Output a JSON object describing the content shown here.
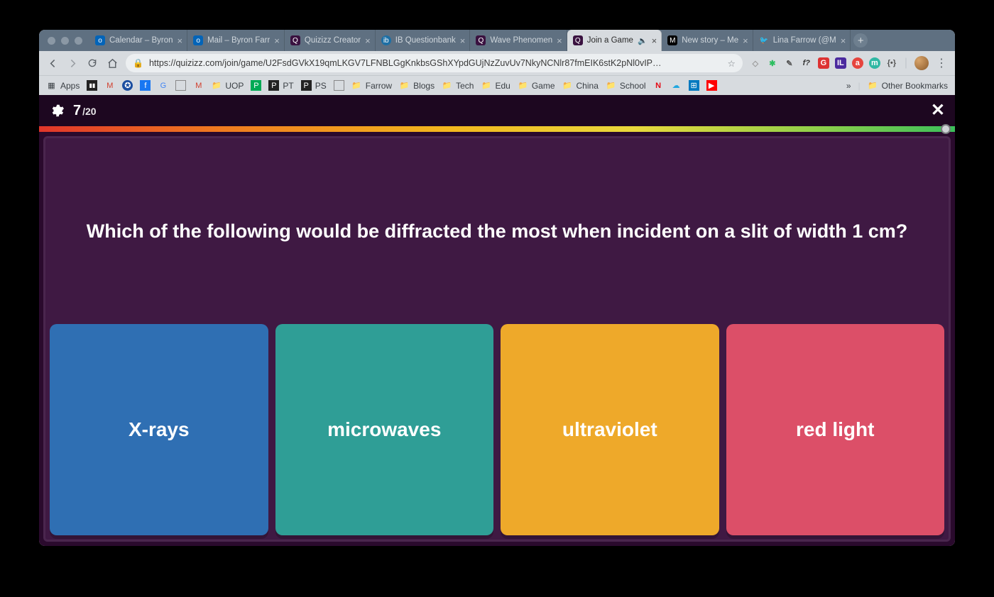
{
  "browser": {
    "tabs": [
      {
        "title": "Calendar – Byron"
      },
      {
        "title": "Mail – Byron Farr"
      },
      {
        "title": "Quizizz Creator"
      },
      {
        "title": "IB Questionbank"
      },
      {
        "title": "Wave Phenomen"
      },
      {
        "title": "Join a Game"
      },
      {
        "title": "New story – Me"
      },
      {
        "title": "Lina Farrow (@M"
      }
    ],
    "active_tab_index": 5,
    "url": "https://quizizz.com/join/game/U2FsdGVkX19qmLKGV7LFNBLGgKnkbsGShXYpdGUjNzZuvUv7NkyNCNlr87fmEIK6stK2pNl0vIP…",
    "bookmarks": [
      {
        "label": "Apps",
        "icon": "grid"
      },
      {
        "label": "",
        "icon": "box"
      },
      {
        "label": "",
        "icon": "gmail"
      },
      {
        "label": "",
        "icon": "circle-blue"
      },
      {
        "label": "",
        "icon": "fb"
      },
      {
        "label": "",
        "icon": "google"
      },
      {
        "label": "",
        "icon": "doc"
      },
      {
        "label": "",
        "icon": "gmail2"
      },
      {
        "label": "UOP",
        "icon": "folder"
      },
      {
        "label": "",
        "icon": "p-green"
      },
      {
        "label": "PT",
        "icon": "p-dark"
      },
      {
        "label": "PS",
        "icon": "p-dark"
      },
      {
        "label": "",
        "icon": "doc"
      },
      {
        "label": "Farrow",
        "icon": "folder"
      },
      {
        "label": "Blogs",
        "icon": "folder"
      },
      {
        "label": "Tech",
        "icon": "folder"
      },
      {
        "label": "Edu",
        "icon": "folder"
      },
      {
        "label": "Game",
        "icon": "folder"
      },
      {
        "label": "China",
        "icon": "folder"
      },
      {
        "label": "School",
        "icon": "folder"
      },
      {
        "label": "",
        "icon": "netflix"
      },
      {
        "label": "",
        "icon": "cloud"
      },
      {
        "label": "",
        "icon": "trello"
      },
      {
        "label": "",
        "icon": "youtube"
      }
    ],
    "other_bookmarks_label": "Other Bookmarks",
    "overflow_glyph": "»"
  },
  "quiz": {
    "current": "7",
    "total": "/20",
    "question": "Which of the following would be diffracted the most when incident on a slit of width 1 cm?",
    "answers": [
      {
        "label": "X-rays",
        "color": "#2f6fb3"
      },
      {
        "label": "microwaves",
        "color": "#2f9e96"
      },
      {
        "label": "ultraviolet",
        "color": "#eea92a"
      },
      {
        "label": "red light",
        "color": "#dc4f68"
      }
    ]
  }
}
